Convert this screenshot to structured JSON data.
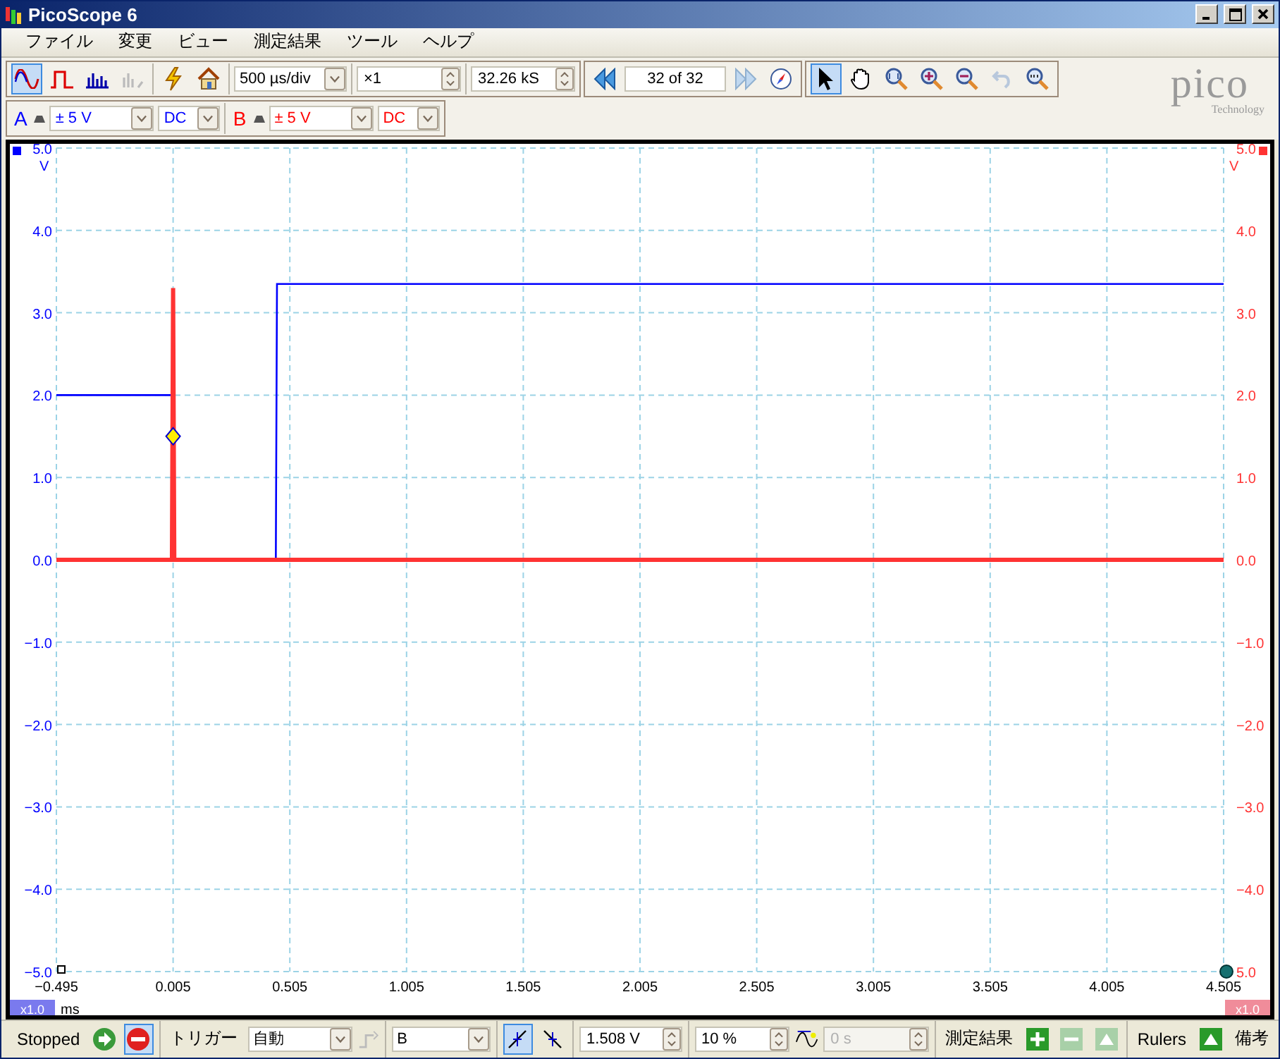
{
  "window": {
    "title": "PicoScope 6"
  },
  "menu": [
    "ファイル",
    "変更",
    "ビュー",
    "測定結果",
    "ツール",
    "ヘルプ"
  ],
  "toolbar": {
    "views": [
      {
        "kind": "scope",
        "selected": true
      },
      {
        "kind": "persistence",
        "selected": false
      },
      {
        "kind": "spectrum",
        "selected": false
      },
      {
        "kind": "disabled",
        "selected": false
      }
    ],
    "timebase": "500 µs/div",
    "multiplier": "×1",
    "samples": "32.26 kS",
    "buffer": "32 of 32",
    "tools": [
      {
        "kind": "pointer",
        "selected": true
      },
      {
        "kind": "hand",
        "selected": false
      },
      {
        "kind": "zoom-fit",
        "selected": false
      },
      {
        "kind": "zoom-in",
        "selected": false
      },
      {
        "kind": "zoom-out",
        "selected": false
      },
      {
        "kind": "undo",
        "selected": false
      },
      {
        "kind": "zoom-100",
        "selected": false
      }
    ]
  },
  "logo": {
    "name": "pico",
    "tagline": "Technology"
  },
  "channels": [
    {
      "label": "A",
      "range": "± 5 V",
      "coupling": "DC",
      "color": "#0000ff"
    },
    {
      "label": "B",
      "range": "± 5 V",
      "coupling": "DC",
      "color": "#ff0000"
    }
  ],
  "plot": {
    "y_unit_left": "V",
    "y_unit_right": "V",
    "x_unit": "ms",
    "zoom_left": "x1.0",
    "zoom_right": "x1.0",
    "right_axis_labels": [
      "5.0",
      "4.0",
      "3.0",
      "2.0",
      "1.0",
      "0.0",
      "−1.0",
      "−2.0",
      "−3.0",
      "−4.0",
      "5.0"
    ],
    "chart_data": {
      "type": "line",
      "grid": true,
      "x": [
        -0.495,
        0.0,
        0.005,
        0.01,
        0.44,
        0.445,
        0.45,
        4.505
      ],
      "series": [
        {
          "color": "#0000ff",
          "values": [
            2.0,
            2.0,
            2.0,
            0.0,
            0.0,
            0.0,
            3.35,
            3.35
          ]
        },
        {
          "color": "#ff3333",
          "values": [
            0.0,
            0.0,
            3.3,
            0.0,
            0.0,
            0.0,
            0.0,
            0.0
          ]
        }
      ],
      "xlim": [
        -0.495,
        4.505
      ],
      "ylim": [
        -5,
        5
      ],
      "xticks": [
        {
          "value": -0.495,
          "label": "−0.495"
        },
        {
          "value": 0.005,
          "label": "0.005"
        },
        {
          "value": 0.505,
          "label": "0.505"
        },
        {
          "value": 1.005,
          "label": "1.005"
        },
        {
          "value": 1.505,
          "label": "1.505"
        },
        {
          "value": 2.005,
          "label": "2.005"
        },
        {
          "value": 2.505,
          "label": "2.505"
        },
        {
          "value": 3.005,
          "label": "3.005"
        },
        {
          "value": 3.505,
          "label": "3.505"
        },
        {
          "value": 4.005,
          "label": "4.005"
        },
        {
          "value": 4.505,
          "label": "4.505"
        }
      ],
      "yticks": [
        {
          "value": 5,
          "label": "5.0"
        },
        {
          "value": 4,
          "label": "4.0"
        },
        {
          "value": 3,
          "label": "3.0"
        },
        {
          "value": 2,
          "label": "2.0"
        },
        {
          "value": 1,
          "label": "1.0"
        },
        {
          "value": 0,
          "label": "0.0"
        },
        {
          "value": -1,
          "label": "−1.0"
        },
        {
          "value": -2,
          "label": "−2.0"
        },
        {
          "value": -3,
          "label": "−3.0"
        },
        {
          "value": -4,
          "label": "−4.0"
        },
        {
          "value": -5,
          "label": "−5.0"
        }
      ]
    }
  },
  "status": {
    "state": "Stopped",
    "running": false,
    "trigger_label": "トリガー",
    "trigger_mode": "自動",
    "trigger_source": "B",
    "edges": [
      {
        "kind": "rising",
        "selected": true
      },
      {
        "kind": "falling",
        "selected": false
      }
    ],
    "threshold": "1.508 V",
    "pretrigger": "10 %",
    "delay": {
      "value": "0 s",
      "disabled": true
    },
    "measurements_label": "測定結果",
    "rulers_label": "Rulers",
    "notes_label": "備考"
  }
}
